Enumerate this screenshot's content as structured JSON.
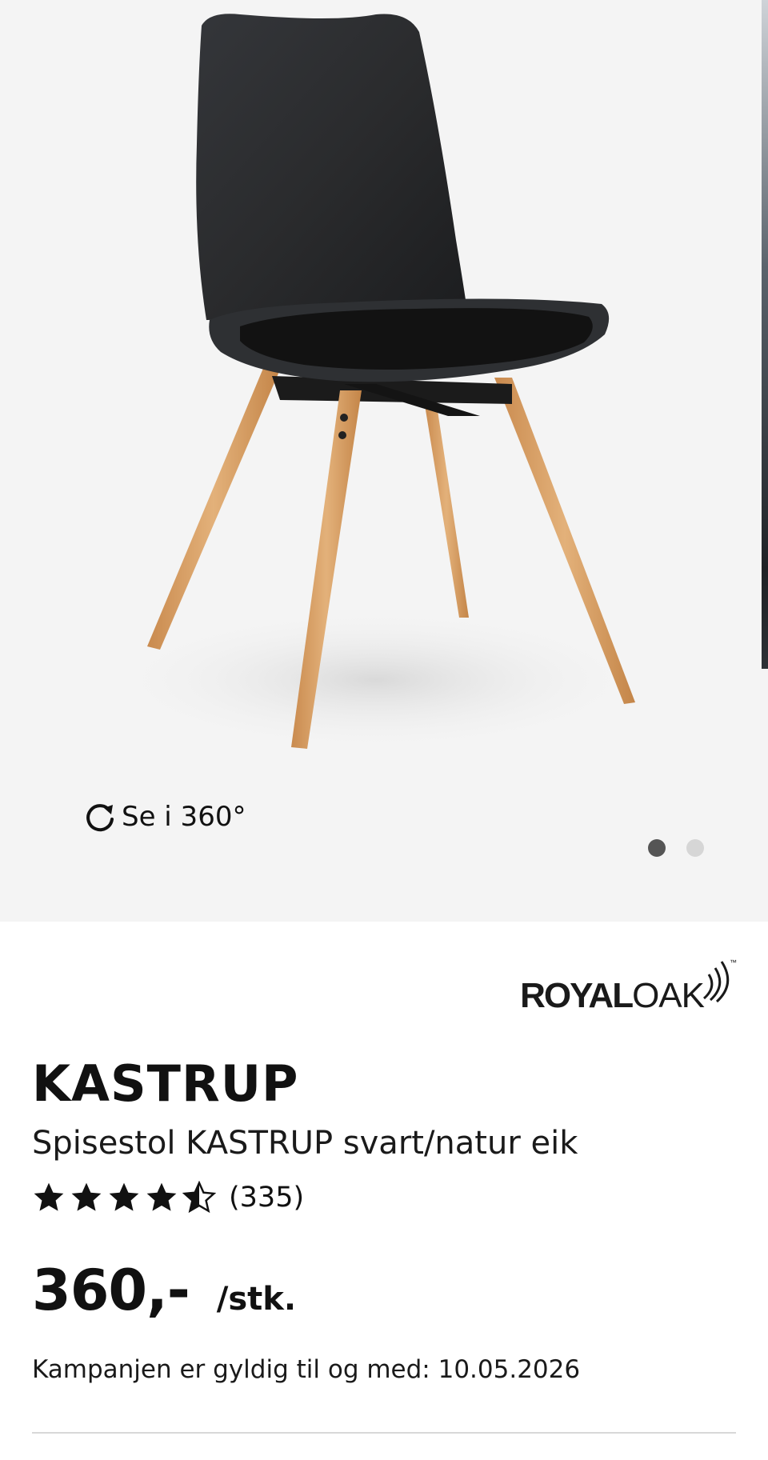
{
  "gallery": {
    "view_360_label": "Se i 360°",
    "icons": {
      "rotate": "rotate-icon"
    },
    "image_count": 2,
    "active_index": 0
  },
  "brand": {
    "part1": "ROYAL",
    "part2": "OAK",
    "trademark": "™"
  },
  "product": {
    "name": "KASTRUP",
    "subtitle": "Spisestol KASTRUP svart/natur eik",
    "rating": 4.5,
    "review_count": "(335)",
    "price": "360,-",
    "price_unit": "/stk.",
    "campaign_text": "Kampanjen er gyldig til og med: 10.05.2026"
  },
  "colors": {
    "gallery_bg": "#f4f4f4",
    "chair_shell": "#2a2b2d",
    "chair_legs": "#d9a46a",
    "star": "#111111",
    "dot_active": "#555555",
    "dot_inactive": "#d6d6d6"
  }
}
